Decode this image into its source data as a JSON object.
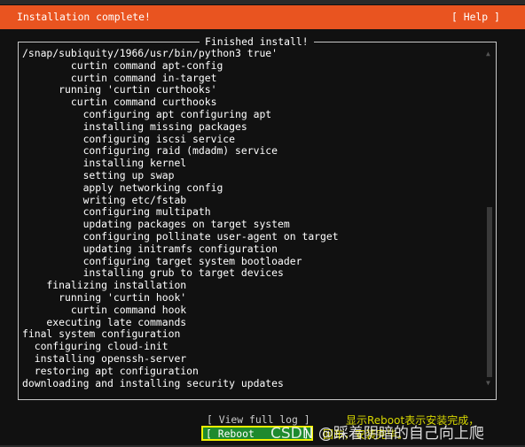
{
  "header": {
    "title": "Installation complete!",
    "help_label": "[ Help ]",
    "color": "#e95420"
  },
  "panel": {
    "title": "Finished install!",
    "lines": [
      "/snap/subiquity/1966/usr/bin/python3 true'",
      "        curtin command apt-config",
      "        curtin command in-target",
      "      running 'curtin curthooks'",
      "        curtin command curthooks",
      "          configuring apt configuring apt",
      "          installing missing packages",
      "          configuring iscsi service",
      "          configuring raid (mdadm) service",
      "          installing kernel",
      "          setting up swap",
      "          apply networking config",
      "          writing etc/fstab",
      "          configuring multipath",
      "          updating packages on target system",
      "          configuring pollinate user-agent on target",
      "          updating initramfs configuration",
      "          configuring target system bootloader",
      "          installing grub to target devices",
      "    finalizing installation",
      "      running 'curtin hook'",
      "        curtin command hook",
      "    executing late commands",
      "final system configuration",
      "  configuring cloud-init",
      "  installing openssh-server",
      "  restoring apt configuration",
      "downloading and installing security updates"
    ],
    "scroll_position": 1.0
  },
  "buttons": {
    "view_log": "[ View full log ]",
    "reboot": "[ Reboot        ]"
  },
  "annotation": {
    "line1": "显示Reboot表示安装完成，",
    "line2": "回车，安装完毕。",
    "color": "#d8d800"
  },
  "watermark": "CSDN @踩着阴暗的自己向上爬"
}
